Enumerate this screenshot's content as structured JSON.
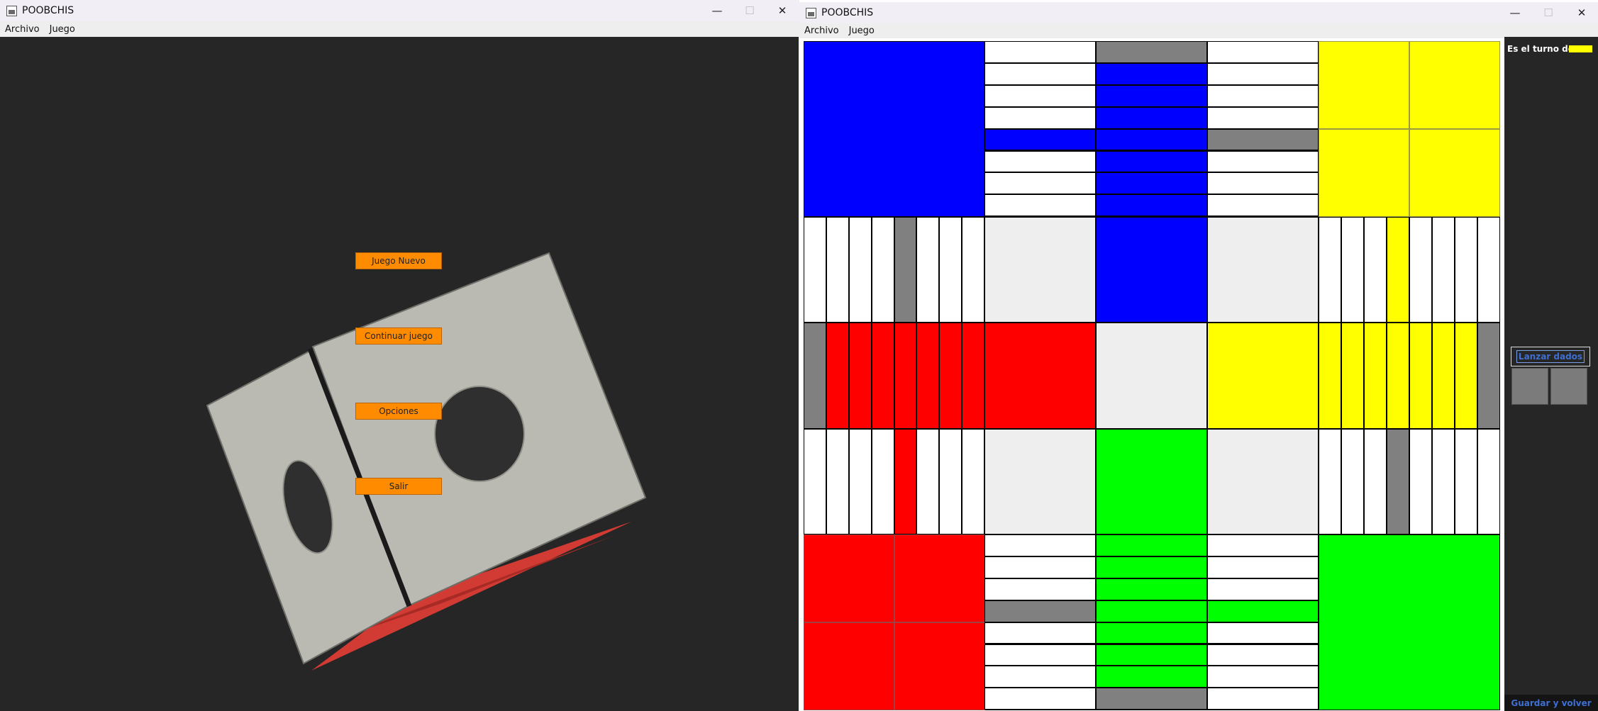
{
  "menu_window": {
    "title": "POOBCHIS",
    "menus": [
      "Archivo",
      "Juego"
    ],
    "buttons": {
      "new_game": "Juego Nuevo",
      "continue_game": "Continuar juego",
      "options": "Opciones",
      "exit": "Salir"
    },
    "button_color": "#ff8c00",
    "background_color": "#262626",
    "die_colors": {
      "face": "#bbbab2",
      "shadow": "#d23b33"
    }
  },
  "board_window": {
    "title": "POOBCHIS",
    "menus": [
      "Archivo",
      "Juego"
    ],
    "turn_label": "Es el turno de:",
    "turn_color": "#ffff00",
    "roll_button": "Lanzar dados",
    "save_button": "Guardar y volver",
    "colors": {
      "blue": "#0000ff",
      "yellow": "#ffff00",
      "red": "#ff0000",
      "green": "#00ff00",
      "safe": "#808080",
      "path": "#ffffff",
      "center": "#eeeeee"
    }
  },
  "window_controls": {
    "minimize": "—",
    "maximize": "☐",
    "close": "✕"
  }
}
